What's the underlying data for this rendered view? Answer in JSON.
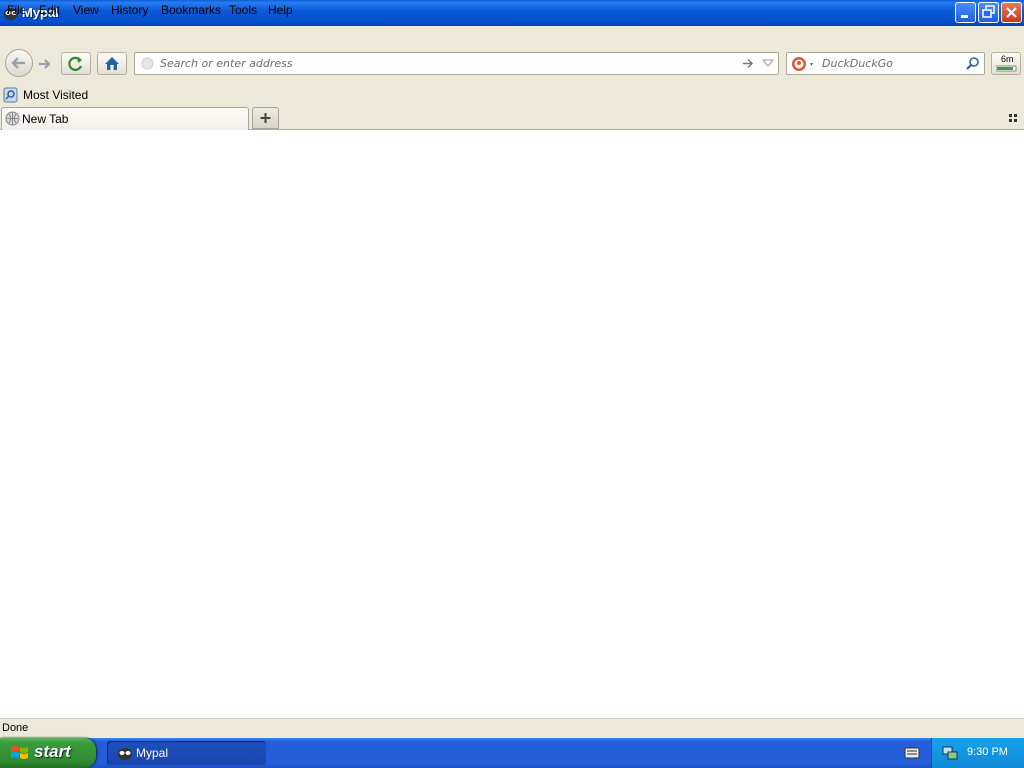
{
  "window": {
    "title": "Mypal"
  },
  "menu": {
    "items": [
      "File",
      "Edit",
      "View",
      "History",
      "Bookmarks",
      "Tools",
      "Help"
    ]
  },
  "navigation": {
    "address_placeholder": "Search or enter address",
    "search_engine": "DuckDuckGo",
    "search_placeholder": "DuckDuckGo",
    "download_indicator": "6m"
  },
  "bookmarks": {
    "items": [
      {
        "label": "Most Visited",
        "icon": "bookmark-folder-icon"
      }
    ]
  },
  "tabs": {
    "items": [
      {
        "label": "New Tab",
        "icon": "globe-icon"
      }
    ]
  },
  "status": {
    "text": "Done"
  },
  "taskbar": {
    "start_label": "start",
    "items": [
      {
        "label": "Mypal"
      }
    ],
    "clock": "9:30 PM"
  },
  "colors": {
    "titlebar": "#0451cf",
    "taskbar": "#245edb",
    "start_button": "#3c9c3c",
    "tray": "#0f8ad8",
    "chrome": "#ece9d8"
  }
}
